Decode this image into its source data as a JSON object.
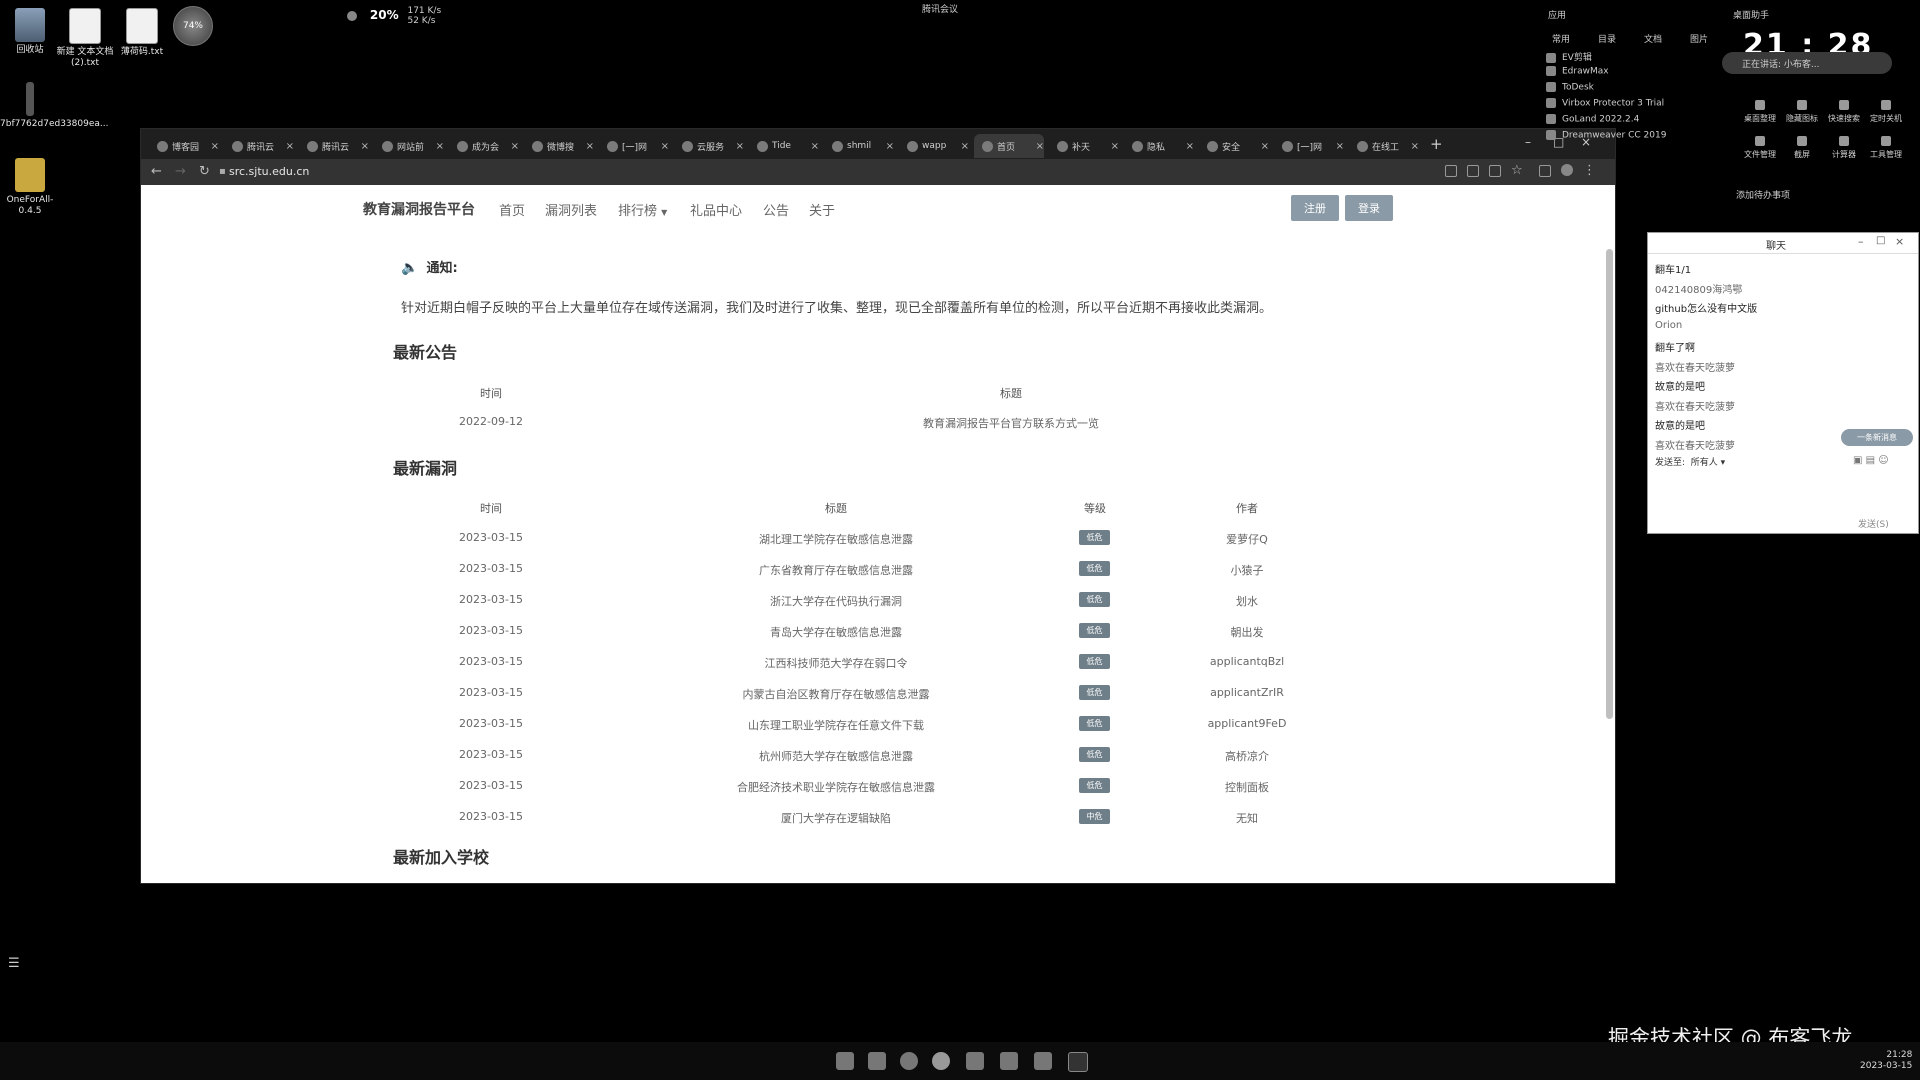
{
  "desktop": {
    "icons": [
      {
        "label": "回收站"
      },
      {
        "label": "新建 文本文档 (2).txt"
      },
      {
        "label": "薄荷码.txt"
      },
      {
        "label": "7bf7762d7ed33809ea..."
      },
      {
        "label": "OneForAll-0.4.5"
      }
    ],
    "avatar_label": "74%",
    "status": {
      "cpu": "20%",
      "net_up": "171 K/s",
      "net_down": "52 K/s"
    },
    "meeting": "腾讯会议"
  },
  "browser": {
    "tabs": [
      "博客园",
      "腾讯云",
      "腾讯云",
      "网站前",
      "成为会",
      "微博搜",
      "[一]网",
      "云服务",
      "Tide",
      "shmil",
      "wapp",
      "首页",
      "补天",
      "隐私",
      "安全",
      "[一]网",
      "在线工"
    ],
    "active_tab_index": 11,
    "url": "src.sjtu.edu.cn"
  },
  "site": {
    "brand": "教育漏洞报告平台",
    "nav": [
      "首页",
      "漏洞列表",
      "排行榜",
      "礼品中心",
      "公告",
      "关于"
    ],
    "register": "注册",
    "login": "登录",
    "notice_label": "通知:",
    "notice_text": "针对近期白帽子反映的平台上大量单位存在域传送漏洞，我们及时进行了收集、整理，现已全部覆盖所有单位的检测，所以平台近期不再接收此类漏洞。",
    "announcements": {
      "title": "最新公告",
      "headers": [
        "时间",
        "标题"
      ],
      "rows": [
        {
          "time": "2022-09-12",
          "title": "教育漏洞报告平台官方联系方式一览"
        }
      ]
    },
    "vulns": {
      "title": "最新漏洞",
      "headers": [
        "时间",
        "标题",
        "等级",
        "作者"
      ],
      "rows": [
        {
          "time": "2023-03-15",
          "title": "湖北理工学院存在敏感信息泄露",
          "level": "低危",
          "author": "爱萝仔Q"
        },
        {
          "time": "2023-03-15",
          "title": "广东省教育厅存在敏感信息泄露",
          "level": "低危",
          "author": "小猿子"
        },
        {
          "time": "2023-03-15",
          "title": "浙江大学存在代码执行漏洞",
          "level": "低危",
          "author": "划水"
        },
        {
          "time": "2023-03-15",
          "title": "青岛大学存在敏感信息泄露",
          "level": "低危",
          "author": "朝出发"
        },
        {
          "time": "2023-03-15",
          "title": "江西科技师范大学存在弱口令",
          "level": "低危",
          "author": "applicantqBzl"
        },
        {
          "time": "2023-03-15",
          "title": "内蒙古自治区教育厅存在敏感信息泄露",
          "level": "低危",
          "author": "applicantZrIR"
        },
        {
          "time": "2023-03-15",
          "title": "山东理工职业学院存在任意文件下载",
          "level": "低危",
          "author": "applicant9FeD"
        },
        {
          "time": "2023-03-15",
          "title": "杭州师范大学存在敏感信息泄露",
          "level": "低危",
          "author": "高桥凉介"
        },
        {
          "time": "2023-03-15",
          "title": "合肥经济技术职业学院存在敏感信息泄露",
          "level": "低危",
          "author": "控制面板"
        },
        {
          "time": "2023-03-15",
          "title": "厦门大学存在逻辑缺陷",
          "level": "中危",
          "author": "无知"
        }
      ]
    },
    "schools_title": "最新加入学校"
  },
  "right_panel": {
    "apps_header": "应用",
    "apps_tabs": [
      "常用",
      "目录",
      "文档",
      "图片"
    ],
    "apps": [
      "EV剪辑",
      "EdrawMax",
      "ToDesk",
      "Virbox Protector 3 Trial",
      "GoLand 2022.2.4",
      "Dreamweaver CC 2019"
    ],
    "desktop_assistant": "桌面助手",
    "time": "21 : 28",
    "reminder": "正在讲话: 小布客...",
    "tools": [
      "桌面整理",
      "隐藏图标",
      "快速搜索",
      "定时关机",
      "文件管理",
      "截屏",
      "计算器",
      "工具管理"
    ],
    "add_todo": "添加待办事项"
  },
  "chat": {
    "title": "聊天",
    "lines": [
      {
        "text": "翻车1/1",
        "bold": true
      },
      {
        "text": "042140809海鸿鄂",
        "bold": false
      },
      {
        "text": "github怎么没有中文版",
        "bold": true
      },
      {
        "text": "Orion",
        "bold": false
      },
      {
        "text": "翻车了啊",
        "bold": true
      },
      {
        "text": "喜欢在春天吃菠萝",
        "bold": false
      },
      {
        "text": "故意的是吧",
        "bold": true
      },
      {
        "text": "喜欢在春天吃菠萝",
        "bold": false
      },
      {
        "text": "故意的是吧",
        "bold": true
      },
      {
        "text": "喜欢在春天吃菠萝",
        "bold": false
      }
    ],
    "new_msg": "一条新消息",
    "send_to_label": "发送至:",
    "send_to_value": "所有人",
    "send_button": "发送(S)"
  },
  "taskbar": {
    "clock_time": "21:28",
    "clock_date": "2023-03-15"
  },
  "watermark": "掘金技术社区 @ 布客飞龙"
}
